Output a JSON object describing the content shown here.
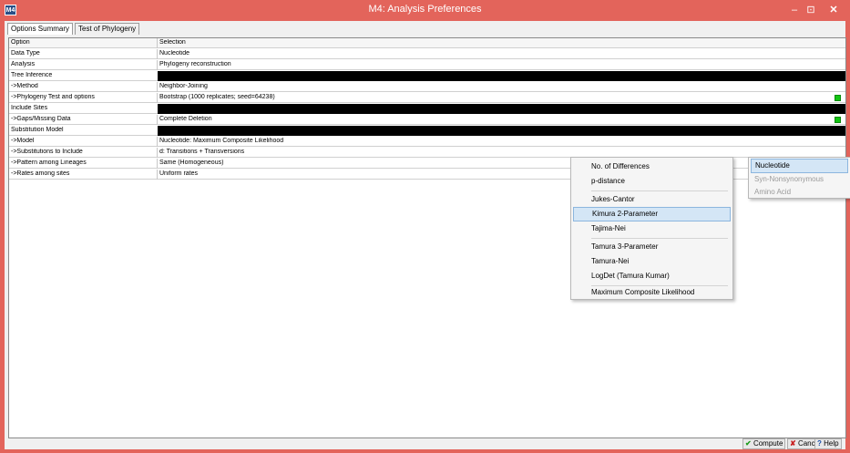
{
  "window": {
    "app_icon": "M4",
    "title": "M4: Analysis Preferences",
    "min_glyph": "–",
    "max_glyph": "⊡",
    "close_glyph": "✕",
    "frame_color": "#e3645b"
  },
  "tabs": [
    {
      "label": "Options Summary"
    },
    {
      "label": "Test of Phylogeny"
    }
  ],
  "grid": {
    "header": {
      "option": "Option",
      "selection": "Selection"
    },
    "rows": [
      {
        "option": "Data Type",
        "selection": "Nucleotide",
        "kind": "value"
      },
      {
        "option": "Analysis",
        "selection": "Phylogeny reconstruction",
        "kind": "value"
      },
      {
        "option": "Tree Inference",
        "selection": "",
        "kind": "section"
      },
      {
        "option": "->Method",
        "selection": "Neighbor-Joining",
        "kind": "value"
      },
      {
        "option": "->Phylogeny Test and options",
        "selection": "Bootstrap (1000 replicates; seed=64238)",
        "kind": "value",
        "editable": true
      },
      {
        "option": "Include Sites",
        "selection": "",
        "kind": "section"
      },
      {
        "option": "->Gaps/Missing Data",
        "selection": "Complete Deletion",
        "kind": "value",
        "editable": true
      },
      {
        "option": "Substitution Model",
        "selection": "",
        "kind": "section"
      },
      {
        "option": "->Model",
        "selection": "Nucleotide: Maximum Composite Likelihood",
        "kind": "value"
      },
      {
        "option": "->Substitutions to Include",
        "selection": "d: Transitions + Transversions",
        "kind": "value"
      },
      {
        "option": "->Pattern among Lineages",
        "selection": "Same (Homogeneous)",
        "kind": "value"
      },
      {
        "option": "->Rates among sites",
        "selection": "Uniform rates",
        "kind": "value",
        "editable": true
      }
    ]
  },
  "model_menu": {
    "items": [
      {
        "label": "No. of Differences"
      },
      {
        "label": "p-distance"
      },
      {
        "label": "Jukes-Cantor"
      },
      {
        "label": "Kimura 2-Parameter",
        "highlighted": true
      },
      {
        "label": "Tajima-Nei"
      },
      {
        "label": "Tamura 3-Parameter"
      },
      {
        "label": "Tamura-Nei"
      },
      {
        "label": "LogDet (Tamura Kumar)"
      },
      {
        "label": "Maximum Composite Likelihood"
      }
    ]
  },
  "datatype_menu": {
    "items": [
      {
        "label": "Nucleotide",
        "highlighted": true
      },
      {
        "label": "Syn-Nonsynonymous",
        "disabled": true
      },
      {
        "label": "Amino Acid",
        "disabled": true
      }
    ]
  },
  "buttons": {
    "compute": {
      "label": "Compute",
      "icon": "check-icon"
    },
    "cancel": {
      "label": "Cancel",
      "icon": "x-icon"
    },
    "help": {
      "label": "Help",
      "icon": "help-icon"
    }
  }
}
